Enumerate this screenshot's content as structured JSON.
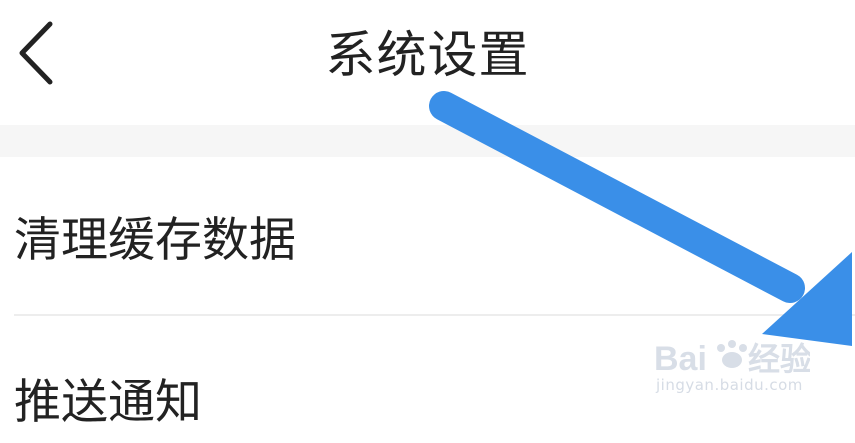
{
  "header": {
    "title": "系统设置",
    "back_icon": "chevron-left-icon"
  },
  "settings": {
    "items": [
      {
        "label": "清理缓存数据"
      },
      {
        "label": "推送通知"
      }
    ]
  },
  "annotation": {
    "arrow_color": "#3a8fe8"
  },
  "watermark": {
    "brand": "Baidu经验",
    "url": "jingyan.baidu.com"
  }
}
